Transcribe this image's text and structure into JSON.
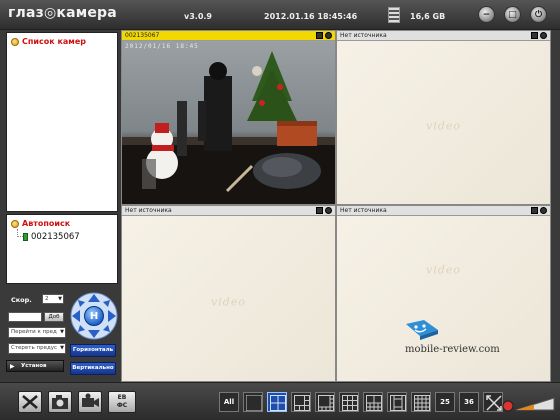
{
  "header": {
    "logo": "глаз◎камера",
    "version": "v3.0.9",
    "datetime": "2012.01.16 18:45:46",
    "disk_free": "16,6 GB",
    "buttons": [
      {
        "name": "minimize",
        "glyph": "−"
      },
      {
        "name": "restore",
        "glyph": "□"
      },
      {
        "name": "power",
        "glyph": "⏻"
      }
    ]
  },
  "left": {
    "camera_list_title": "Список камер",
    "autosearch_title": "Автопоиск",
    "found_cameras": [
      "002135067"
    ],
    "speed_label": "Скор.",
    "speed_value": "2",
    "add_button": "Доб",
    "goto_preset": "Перейти к пред",
    "erase_preset": "Стереть предус",
    "horizontal_button": "Горизонталь",
    "vertical_button": "Вертикально",
    "install_button": "Установ"
  },
  "panes": [
    {
      "title": "002135067",
      "active": true,
      "timestamp": "2012/01/16 18:45"
    },
    {
      "title": "Нет источника",
      "active": false,
      "placeholder": "video"
    },
    {
      "title": "Нет источника",
      "active": false,
      "placeholder": "video"
    },
    {
      "title": "Нет источника",
      "active": false,
      "placeholder": "video"
    }
  ],
  "watermark": {
    "text": "mobile-review.com"
  },
  "toolbar": {
    "tools": [
      {
        "name": "settings",
        "icon": "tools-icon"
      },
      {
        "name": "snapshot",
        "icon": "camera-icon"
      },
      {
        "name": "recorder",
        "icon": "camcorder-icon"
      },
      {
        "name": "archive",
        "label": "ЕВ\nФС"
      }
    ],
    "layouts": [
      "All",
      "1",
      "4",
      "6",
      "8",
      "9",
      "10",
      "13",
      "16",
      "25",
      "36",
      "fullscreen"
    ],
    "selected_layout": "4"
  },
  "colors": {
    "accent_yellow": "#f0d800",
    "title_red": "#cc1111",
    "ptz_blue": "#1e61c9"
  }
}
